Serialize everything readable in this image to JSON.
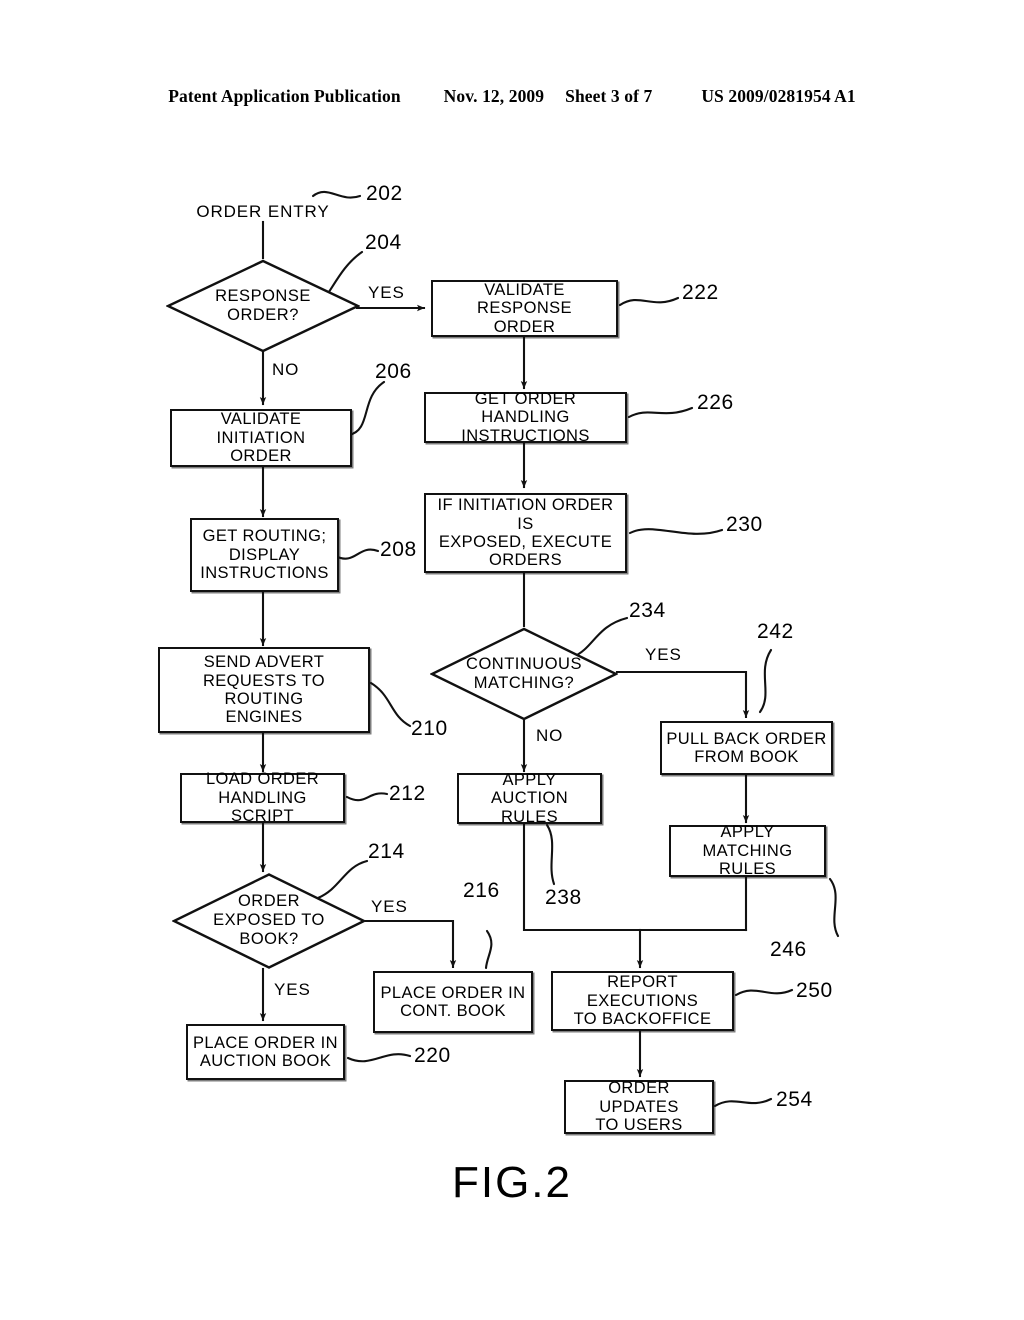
{
  "header": {
    "publication": "Patent Application Publication",
    "date": "Nov. 12, 2009",
    "sheet": "Sheet 3 of 7",
    "patent_number": "US 2009/0281954 A1"
  },
  "figure": {
    "caption": "FIG.2",
    "type": "flowchart"
  },
  "nodes": {
    "order_entry": "ORDER ENTRY",
    "response_order": "RESPONSE\nORDER?",
    "validate_response_order": "VALIDATE RESPONSE\nORDER",
    "validate_initiation_order": "VALIDATE INITIATION\nORDER",
    "get_order_handling": "GET ORDER HANDLING\nINSTRUCTIONS",
    "get_routing": "GET ROUTING;\nDISPLAY\nINSTRUCTIONS",
    "if_initiation_exposed": "IF INITIATION ORDER IS\nEXPOSED, EXECUTE\nORDERS",
    "send_advert": "SEND ADVERT\nREQUESTS TO ROUTING\nENGINES",
    "continuous_matching": "CONTINUOUS\nMATCHING?",
    "pull_back_order": "PULL BACK ORDER\nFROM BOOK",
    "load_order_script": "LOAD ORDER\nHANDLING SCRIPT",
    "apply_auction_rules": "APPLY AUCTION\nRULES",
    "apply_matching_rules": "APPLY MATCHING\nRULES",
    "order_exposed": "ORDER\nEXPOSED TO\nBOOK?",
    "place_order_cont_book": "PLACE ORDER IN\nCONT. BOOK",
    "report_executions": "REPORT EXECUTIONS\nTO BACKOFFICE",
    "place_order_auction_book": "PLACE ORDER IN\nAUCTION BOOK",
    "order_updates": "ORDER UPDATES\nTO USERS"
  },
  "edge_labels": {
    "response_yes": "YES",
    "response_no": "NO",
    "matching_yes": "YES",
    "matching_no": "NO",
    "exposed_yes_right": "YES",
    "exposed_yes_down": "YES"
  },
  "refs": {
    "r202": "202",
    "r204": "204",
    "r206": "206",
    "r208": "208",
    "r210": "210",
    "r212": "212",
    "r214": "214",
    "r216": "216",
    "r220": "220",
    "r222": "222",
    "r226": "226",
    "r230": "230",
    "r234": "234",
    "r238": "238",
    "r242": "242",
    "r246": "246",
    "r250": "250",
    "r254": "254"
  },
  "colors": {
    "ink": "#111111",
    "paper": "#ffffff"
  }
}
